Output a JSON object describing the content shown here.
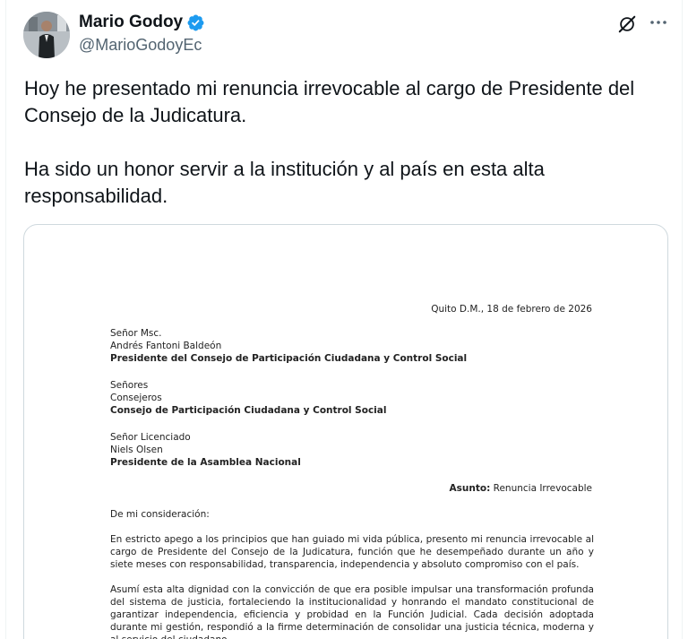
{
  "author": {
    "display_name": "Mario Godoy",
    "handle": "@MarioGodoyEc",
    "avatar_icon": "person-photo",
    "verified_icon": "verified-badge-icon",
    "verified_color": "#1d9bf0"
  },
  "header_actions": {
    "grok_icon": "grok-icon",
    "more_icon": "more-options-icon"
  },
  "tweet": {
    "text": "Hoy he presentado mi renuncia irrevocable al cargo de Presidente del Consejo de la Judicatura.\n\nHa sido un honor servir a la institución y al país en esta alta responsabilidad."
  },
  "document": {
    "date": "Quito D.M., 18 de febrero de 2026",
    "recipient1": {
      "salutation": "Señor Msc.",
      "name": "Andrés Fantoni Baldeón",
      "title": "Presidente del Consejo de Participación Ciudadana y Control Social"
    },
    "recipient2": {
      "salutation": "Señores",
      "name": "Consejeros",
      "title": "Consejo de Participación Ciudadana y Control Social"
    },
    "recipient3": {
      "salutation": "Señor Licenciado",
      "name": "Niels Olsen",
      "title": "Presidente de la Asamblea Nacional"
    },
    "subject_label": "Asunto:",
    "subject_value": "Renuncia Irrevocable",
    "greeting": "De mi consideración:",
    "paragraph1": "En estricto apego a los principios que han guiado mi vida pública, presento mi renuncia irrevocable al cargo de Presidente del Consejo de la Judicatura, función que he desempeñado durante un año y siete meses con responsabilidad, transparencia, independencia y absoluto compromiso con el país.",
    "paragraph2": "Asumí esta alta dignidad con la convicción de que era posible impulsar una transformación profunda del sistema de justicia, fortaleciendo la institucionalidad y honrando el mandato constitucional de garantizar independencia, eficiencia y probidad en la Función Judicial. Cada decisión adoptada durante mi gestión, respondió a la firme determinación de consolidar una justicia técnica, moderna y al servicio del ciudadano."
  }
}
